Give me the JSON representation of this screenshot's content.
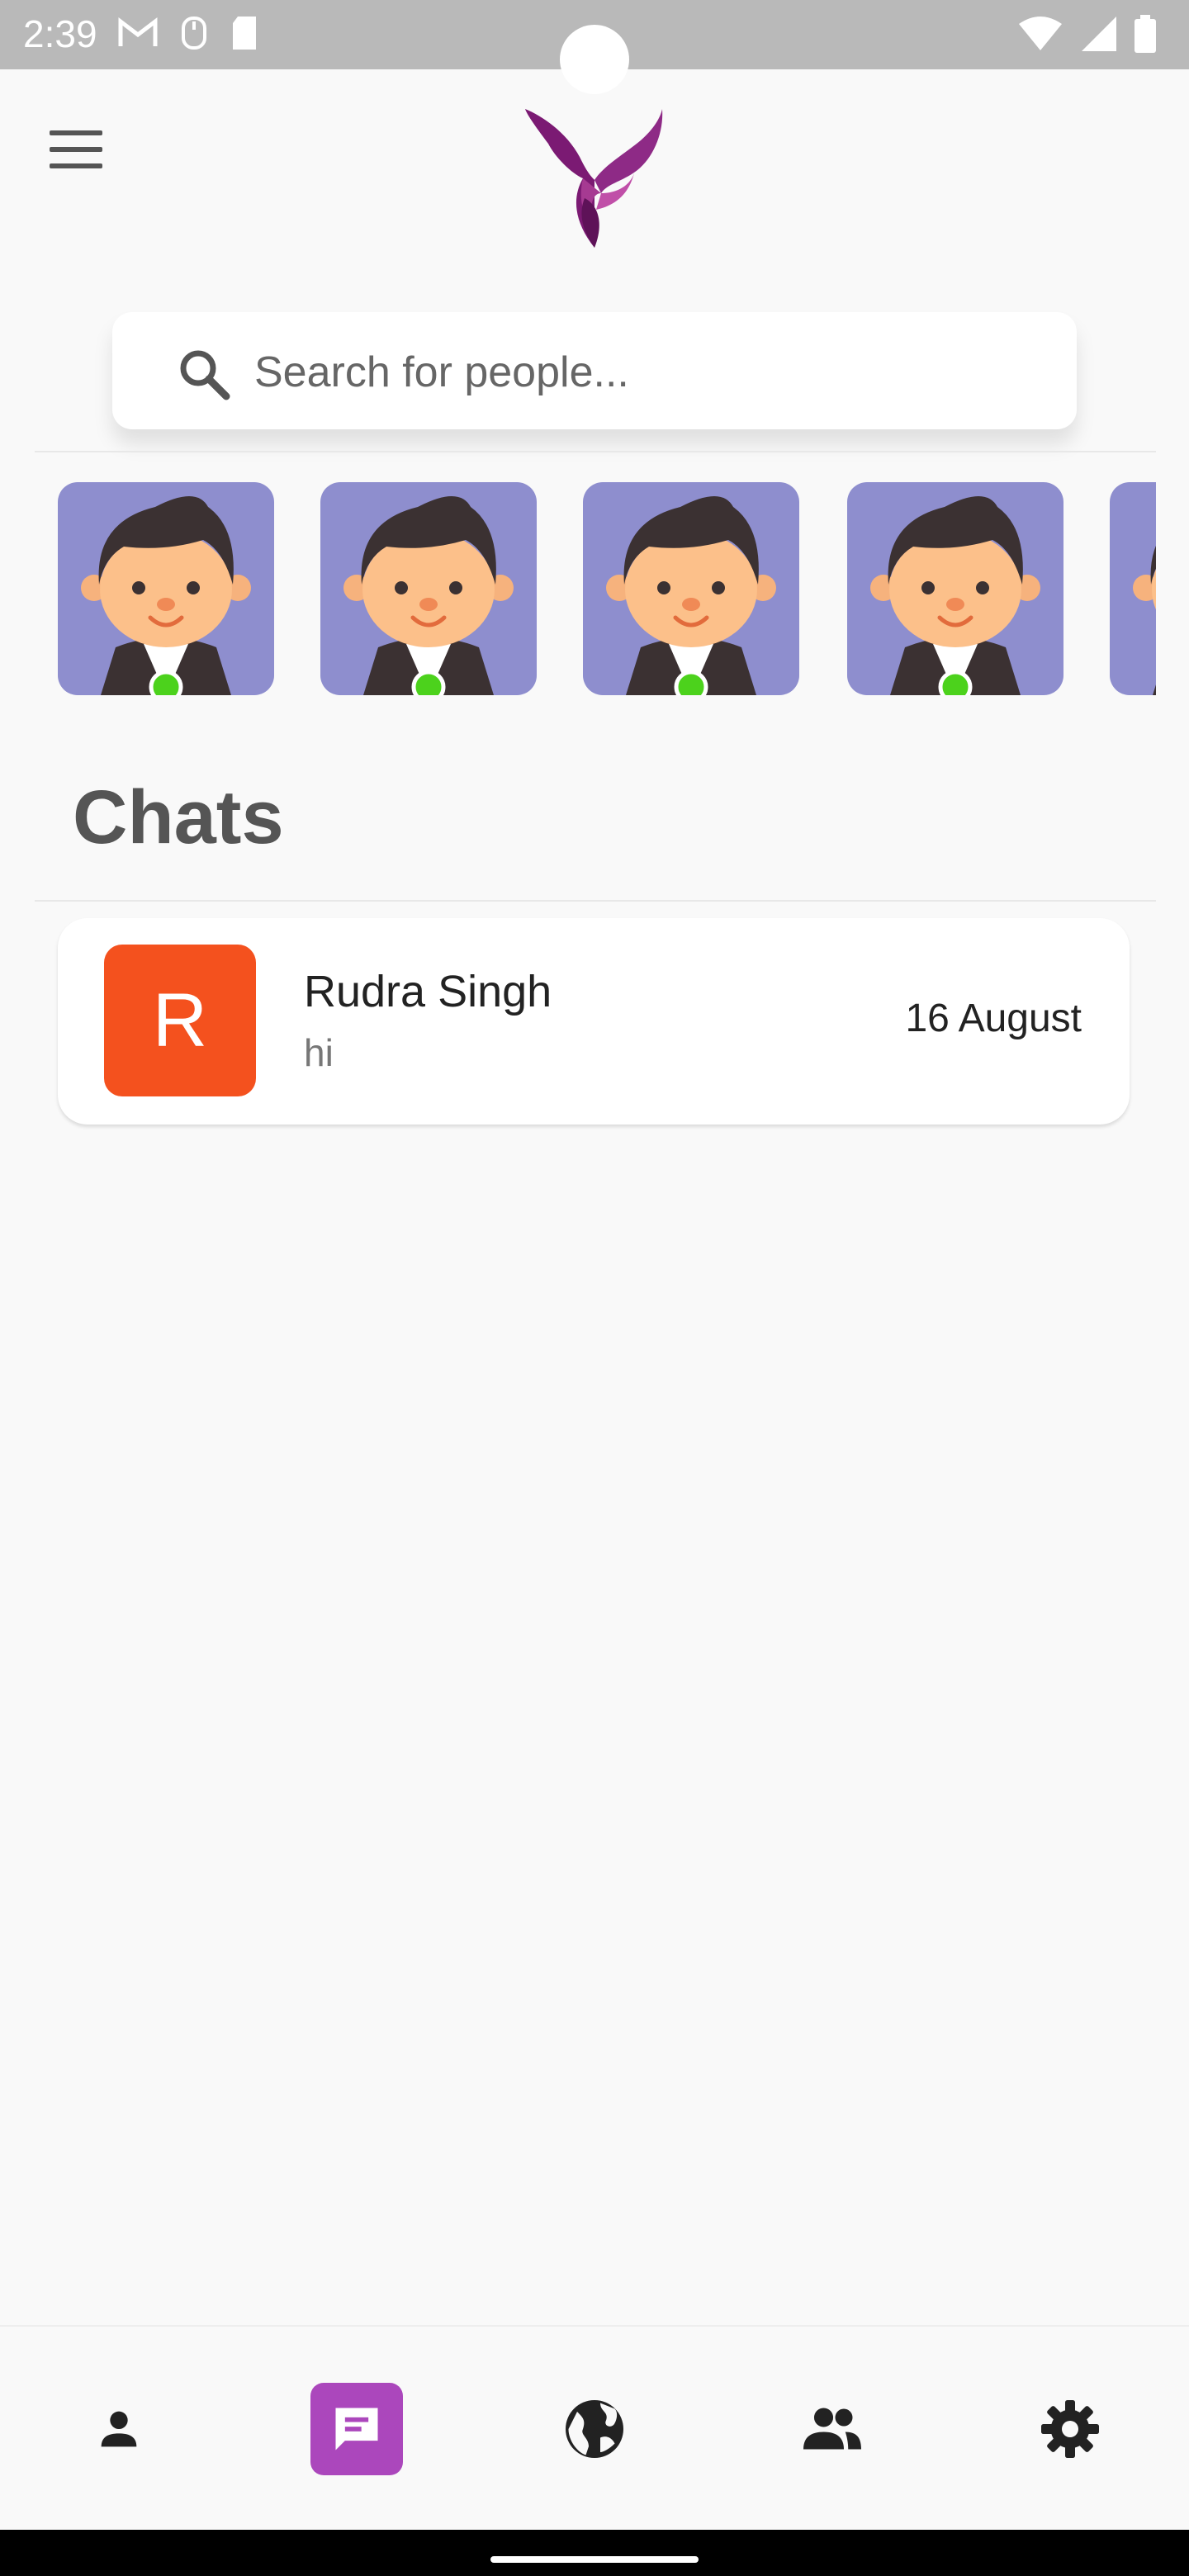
{
  "status_bar": {
    "time": "2:39"
  },
  "search": {
    "placeholder": "Search for people..."
  },
  "online_users": [
    {
      "name": "user-avatar",
      "online": true
    },
    {
      "name": "user-avatar",
      "online": true
    },
    {
      "name": "user-avatar",
      "online": true
    },
    {
      "name": "user-avatar",
      "online": true
    },
    {
      "name": "user-avatar",
      "online": true
    }
  ],
  "section": {
    "title": "Chats"
  },
  "chats": [
    {
      "initial": "R",
      "name": "Rudra Singh",
      "last_message": "hi",
      "date": "16 August",
      "avatar_color": "#f4511e"
    }
  ],
  "bottom_nav": {
    "items": [
      {
        "icon": "person-icon",
        "active": false
      },
      {
        "icon": "chat-icon",
        "active": true
      },
      {
        "icon": "globe-icon",
        "active": false
      },
      {
        "icon": "group-icon",
        "active": false
      },
      {
        "icon": "settings-icon",
        "active": false
      }
    ],
    "active_color": "#ab47bc"
  },
  "colors": {
    "story_bg": "#8e8ece",
    "online_dot": "#4cd21c",
    "brand_purple": "#7b1a73"
  }
}
